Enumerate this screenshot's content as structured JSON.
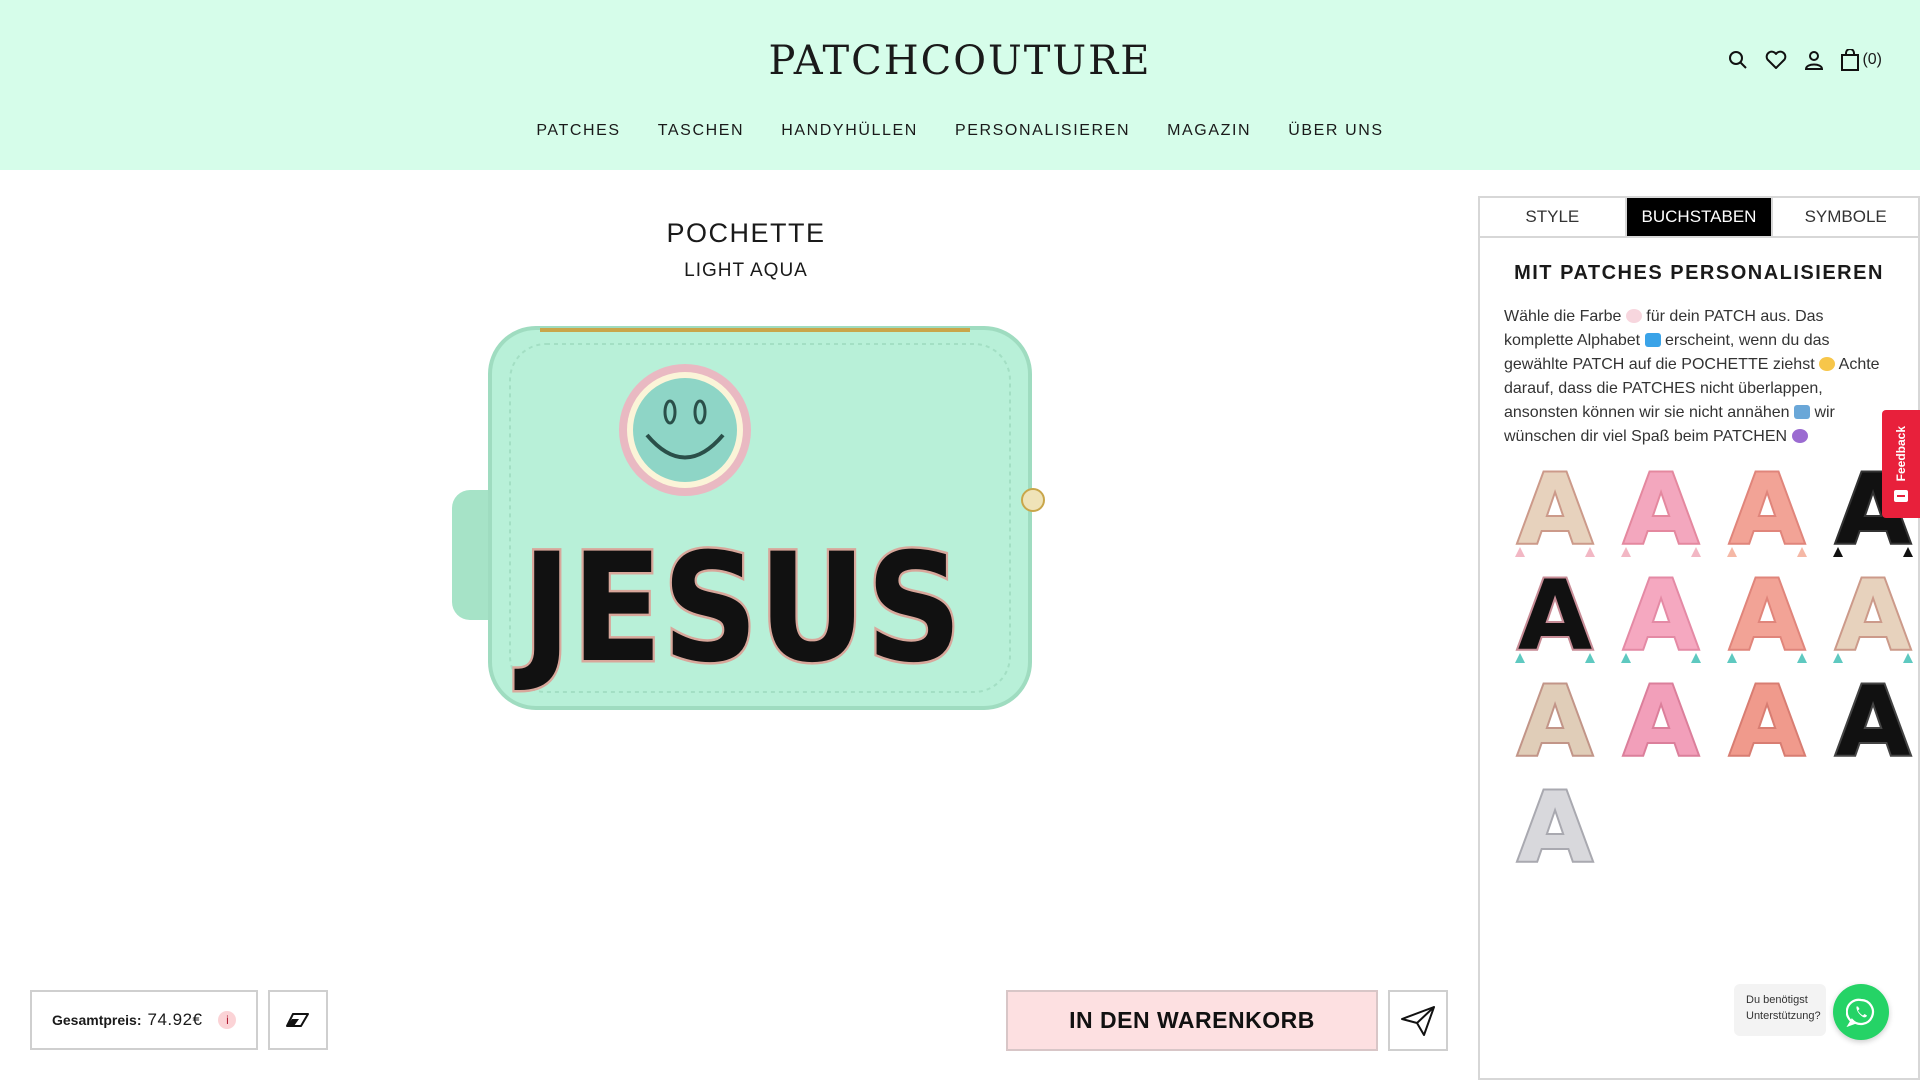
{
  "header": {
    "logo": "PATCHCOUTURE",
    "cart_count": "(0)",
    "icons": [
      "search-icon",
      "heart-icon",
      "user-icon",
      "bag-icon"
    ]
  },
  "nav": {
    "items": [
      "PATCHES",
      "TASCHEN",
      "HANDYHÜLLEN",
      "PERSONALISIEREN",
      "MAGAZIN",
      "ÜBER UNS"
    ]
  },
  "product": {
    "title": "POCHETTE",
    "color": "LIGHT AQUA",
    "patch_text": "JESUS",
    "bag_color": "#b8f0d8"
  },
  "bottom_bar": {
    "price_label": "Gesamtpreis:",
    "price_value": "74.92€",
    "info_icon": "i",
    "cart_button": "IN DEN WARENKORB"
  },
  "panel": {
    "tabs": [
      "STYLE",
      "BUCHSTABEN",
      "SYMBOLE"
    ],
    "active_tab": "BUCHSTABEN",
    "heading": "MIT PATCHES PERSONALISIEREN",
    "description": [
      "Wähle die Farbe",
      "für dein PATCH aus. Das komplette Alphabet",
      "erscheint, wenn du das gewählte PATCH auf die POCHETTE ziehst",
      "Achte darauf, dass die PATCHES nicht überlappen, ansonsten können wir sie nicht annähen",
      "wir wünschen dir viel Spaß beim PATCHEN"
    ],
    "patch_letter": "A",
    "patches": [
      {
        "fill": "#e7d2bd",
        "edge": "#cc9a8a",
        "tassel": "#f2b7c4"
      },
      {
        "fill": "#f3a7be",
        "edge": "#e4889f",
        "tassel": "#f2b7c4"
      },
      {
        "fill": "#f2a396",
        "edge": "#e0857b",
        "tassel": "#f5b8a6"
      },
      {
        "fill": "#111111",
        "edge": "#333333",
        "tassel": "#111111"
      },
      {
        "fill": "#111111",
        "edge": "#c78c96",
        "tassel": "#5ec9c0"
      },
      {
        "fill": "#f5a8c0",
        "edge": "#e48aa5",
        "tassel": "#5ec9c0"
      },
      {
        "fill": "#f2a396",
        "edge": "#e0857b",
        "tassel": "#5ec9c0"
      },
      {
        "fill": "#e7d2bd",
        "edge": "#cc9a8a",
        "tassel": "#5ec9c0"
      },
      {
        "fill": "#e0cdb8",
        "edge": "#c29588",
        "tassel": ""
      },
      {
        "fill": "#f29fba",
        "edge": "#db7f9b",
        "tassel": ""
      },
      {
        "fill": "#f09a8c",
        "edge": "#d87d72",
        "tassel": ""
      },
      {
        "fill": "#111111",
        "edge": "#444444",
        "tassel": ""
      },
      {
        "fill": "#d8d8dc",
        "edge": "#a9a9b0",
        "tassel": ""
      }
    ]
  },
  "feedback": {
    "label": "Feedback"
  },
  "help": {
    "text": "Du benötigst Unterstützung?"
  }
}
